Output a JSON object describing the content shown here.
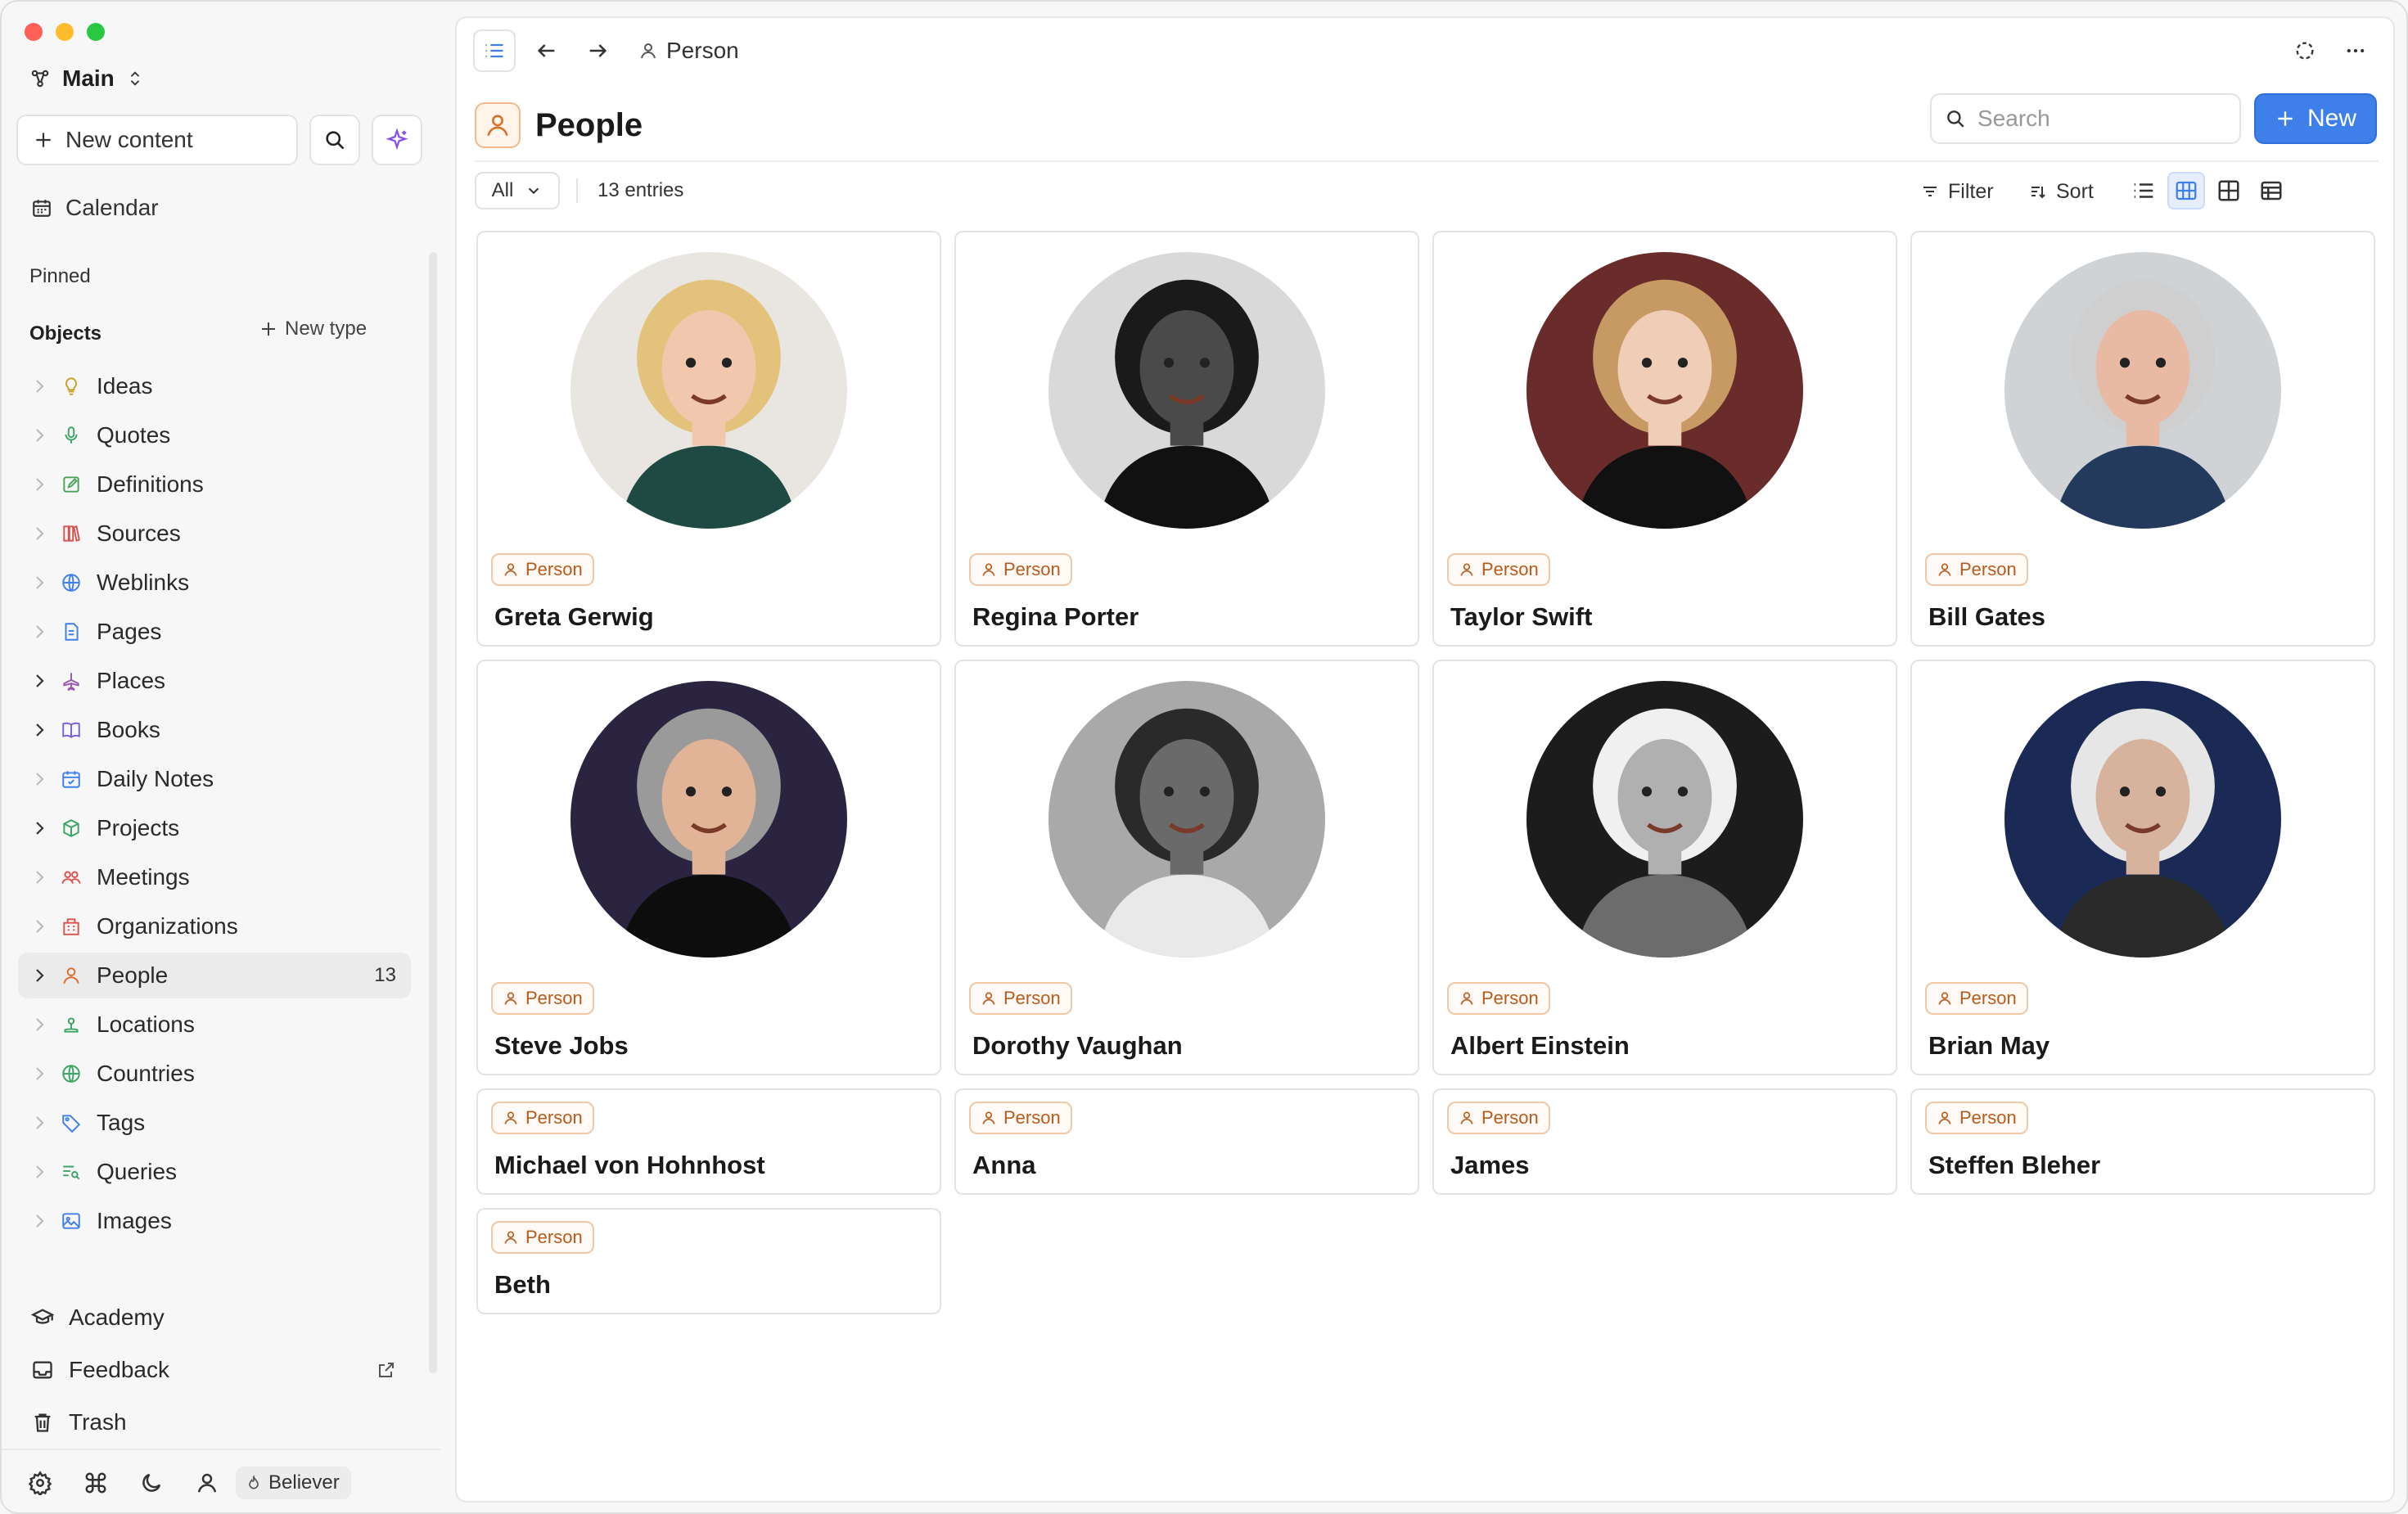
{
  "window": {
    "traffic_colors": [
      "#ff5f57",
      "#febc2e",
      "#28c840"
    ]
  },
  "sidebar": {
    "workspace": "Main",
    "new_content": "New content",
    "calendar": "Calendar",
    "pinned_label": "Pinned",
    "objects_label": "Objects",
    "new_type": "New type",
    "items": [
      {
        "label": "Ideas",
        "icon": "lightbulb-icon",
        "color": "#c9a227",
        "expanded_arrow": false
      },
      {
        "label": "Quotes",
        "icon": "microphone-icon",
        "color": "#3aa564",
        "expanded_arrow": false
      },
      {
        "label": "Definitions",
        "icon": "edit-icon",
        "color": "#4ca35a",
        "expanded_arrow": false
      },
      {
        "label": "Sources",
        "icon": "books-icon",
        "color": "#d9534f",
        "expanded_arrow": false
      },
      {
        "label": "Weblinks",
        "icon": "globe-icon",
        "color": "#3f7fea",
        "expanded_arrow": false
      },
      {
        "label": "Pages",
        "icon": "document-icon",
        "color": "#3f7fea",
        "expanded_arrow": false
      },
      {
        "label": "Places",
        "icon": "plane-icon",
        "color": "#9b59b6",
        "expanded_arrow": true
      },
      {
        "label": "Books",
        "icon": "book-icon",
        "color": "#7b61d6",
        "expanded_arrow": true
      },
      {
        "label": "Daily Notes",
        "icon": "calendar-check-icon",
        "color": "#3f7fea",
        "expanded_arrow": false
      },
      {
        "label": "Projects",
        "icon": "cube-icon",
        "color": "#3aa564",
        "expanded_arrow": true
      },
      {
        "label": "Meetings",
        "icon": "people-icon",
        "color": "#d9534f",
        "expanded_arrow": false
      },
      {
        "label": "Organizations",
        "icon": "building-icon",
        "color": "#d9534f",
        "expanded_arrow": false
      },
      {
        "label": "People",
        "icon": "person-icon",
        "color": "#d9702b",
        "expanded_arrow": true,
        "active": true,
        "count": "13"
      },
      {
        "label": "Locations",
        "icon": "location-icon",
        "color": "#3aa564",
        "expanded_arrow": false
      },
      {
        "label": "Countries",
        "icon": "globe-icon",
        "color": "#3aa564",
        "expanded_arrow": false
      },
      {
        "label": "Tags",
        "icon": "tag-icon",
        "color": "#3f7fea",
        "expanded_arrow": false
      },
      {
        "label": "Queries",
        "icon": "query-icon",
        "color": "#3aa564",
        "expanded_arrow": false
      },
      {
        "label": "Images",
        "icon": "image-icon",
        "color": "#3f7fea",
        "expanded_arrow": false
      }
    ],
    "academy": "Academy",
    "feedback": "Feedback",
    "trash": "Trash",
    "believer": "Believer"
  },
  "topbar": {
    "breadcrumb": "Person"
  },
  "page": {
    "title": "People",
    "search_placeholder": "Search",
    "new_button": "New",
    "filter_all": "All",
    "entries": "13 entries",
    "filter": "Filter",
    "sort": "Sort",
    "badge_label": "Person",
    "accent": "#3f7fea"
  },
  "cards": [
    {
      "name": "Greta Gerwig",
      "photo": true
    },
    {
      "name": "Regina Porter",
      "photo": true
    },
    {
      "name": "Taylor Swift",
      "photo": true
    },
    {
      "name": "Bill Gates",
      "photo": true
    },
    {
      "name": "Steve Jobs",
      "photo": true
    },
    {
      "name": "Dorothy Vaughan",
      "photo": true
    },
    {
      "name": "Albert Einstein",
      "photo": true
    },
    {
      "name": "Brian May",
      "photo": true
    },
    {
      "name": "Michael von Hohnhost",
      "photo": false
    },
    {
      "name": "Anna",
      "photo": false
    },
    {
      "name": "James",
      "photo": false
    },
    {
      "name": "Steffen Bleher",
      "photo": false
    },
    {
      "name": "Beth",
      "photo": false
    }
  ]
}
